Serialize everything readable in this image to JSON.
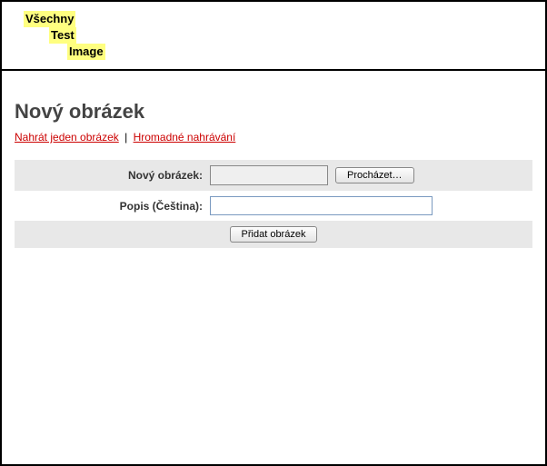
{
  "breadcrumb": {
    "items": [
      {
        "label": "Všechny"
      },
      {
        "label": "Test"
      },
      {
        "label": "Image"
      }
    ]
  },
  "page": {
    "title": "Nový obrázek"
  },
  "tabs": {
    "single": "Nahrát jeden obrázek",
    "separator": "|",
    "bulk": "Hromadné nahrávání"
  },
  "form": {
    "file_label": "Nový obrázek:",
    "browse_label": "Procházet…",
    "desc_label": "Popis (Čeština):",
    "desc_value": "",
    "submit_label": "Přidat obrázek"
  }
}
